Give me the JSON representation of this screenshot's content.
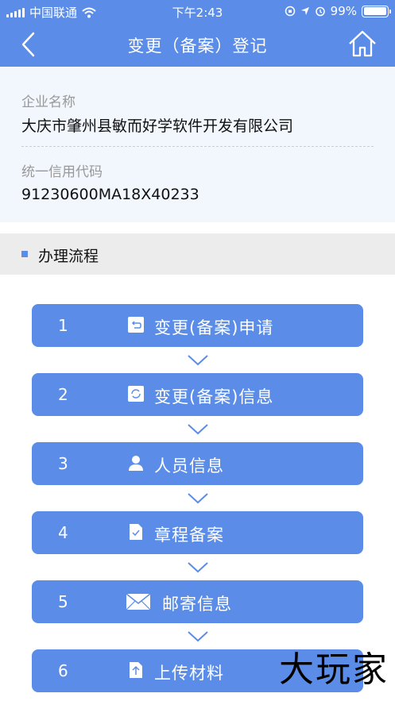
{
  "status_bar": {
    "carrier": "中国联通",
    "time": "下午2:43",
    "battery_text": "99%",
    "battery_level": 0.99
  },
  "nav": {
    "title": "变更（备案）登记"
  },
  "company": {
    "name_label": "企业名称",
    "name_value": "大庆市肇州县敏而好学软件开发有限公司",
    "code_label": "统一信用代码",
    "code_value": "91230600MA18X40233"
  },
  "section": {
    "title": "办理流程"
  },
  "steps": [
    {
      "num": "1",
      "label": "变更(备案)申请",
      "icon": "return-doc-icon"
    },
    {
      "num": "2",
      "label": "变更(备案)信息",
      "icon": "refresh-doc-icon"
    },
    {
      "num": "3",
      "label": "人员信息",
      "icon": "person-icon"
    },
    {
      "num": "4",
      "label": "章程备案",
      "icon": "doc-check-icon"
    },
    {
      "num": "5",
      "label": "邮寄信息",
      "icon": "envelope-icon"
    },
    {
      "num": "6",
      "label": "上传材料",
      "icon": "upload-icon"
    }
  ],
  "watermark": "大玩家",
  "colors": {
    "primary": "#5b8de8",
    "info_bg": "#f2f6fd",
    "section_bg": "#ececec"
  }
}
